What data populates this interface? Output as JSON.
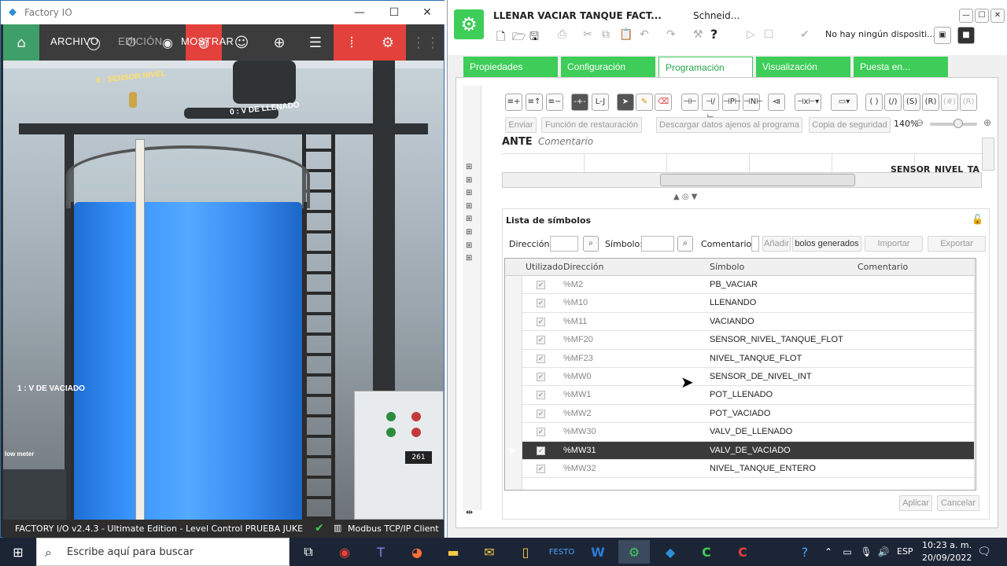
{
  "factory_io": {
    "window_title": "Factory IO",
    "toolbar": {
      "archivo": "ARCHIVO",
      "edicion": "EDICIÓN",
      "mostrar": "MOSTRAR"
    },
    "scene_labels": {
      "sensor_nivel": "0 : SENSOR NIVEL",
      "v_llenado": "0 : V DE LLENADO",
      "v_vaciado": "1 : V DE VACIADO",
      "flow_meter": "low meter",
      "panel_display": "261"
    },
    "status": {
      "left": "FACTORY I/O v2.4.3 - Ultimate Edition - Level Control PRUEBA JUKE",
      "right": "Modbus TCP/IP Client"
    }
  },
  "control_expert": {
    "title": "LLENAR VACIAR TANQUE  FACT...",
    "title2": "Schneid...",
    "device_status": "No hay ningún dispositi...",
    "tabs": [
      "Propiedades",
      "Configuración",
      "Programación",
      "Visualización",
      "Puesta en..."
    ],
    "active_tab": 2,
    "actions": {
      "enviar": "Enviar",
      "restauracion": "Función de restauración",
      "descargar": "Descargar datos ajenos al programa",
      "copia": "Copia de seguridad",
      "zoom": "140%"
    },
    "ladder": {
      "partial_label": "ANTE",
      "comment": "Comentario",
      "sensor_label": "SENSOR_NIVEL_TA"
    },
    "symbols": {
      "title": "Lista de símbolos",
      "direccion_label": "Dirección:",
      "simbolo_label": "Símbolo:",
      "comentario_label": "Comentario:",
      "anadir": "Añadir",
      "generados": "bolos generados",
      "importar": "Importar",
      "exportar": "Exportar",
      "headers": [
        "Utilizado",
        "Dirección",
        "Símbolo",
        "Comentario"
      ],
      "rows": [
        {
          "addr": "%M2",
          "sym": "PB_VACIAR"
        },
        {
          "addr": "%M10",
          "sym": "LLENANDO"
        },
        {
          "addr": "%M11",
          "sym": "VACIANDO"
        },
        {
          "addr": "%MF20",
          "sym": "SENSOR_NIVEL_TANQUE_FLOT"
        },
        {
          "addr": "%MF23",
          "sym": "NIVEL_TANQUE_FLOT"
        },
        {
          "addr": "%MW0",
          "sym": "SENSOR_DE_NIVEL_INT"
        },
        {
          "addr": "%MW1",
          "sym": "POT_LLENADO"
        },
        {
          "addr": "%MW2",
          "sym": "POT_VACIADO"
        },
        {
          "addr": "%MW30",
          "sym": "VALV_DE_LLENADO"
        },
        {
          "addr": "%MW31",
          "sym": "VALV_DE_VACIADO"
        },
        {
          "addr": "%MW32",
          "sym": "NIVEL_TANQUE_ENTERO"
        }
      ],
      "selected_row": 9,
      "aplicar": "Aplicar",
      "cancelar": "Cancelar"
    }
  },
  "taskbar": {
    "search_placeholder": "Escribe aquí para buscar",
    "lang": "ESP",
    "time": "10:23 a. m.",
    "date": "20/09/2022"
  },
  "colors": {
    "schneider_green": "#3dcd58",
    "factory_red": "#e3413c",
    "water_blue": "#3a95ff"
  }
}
